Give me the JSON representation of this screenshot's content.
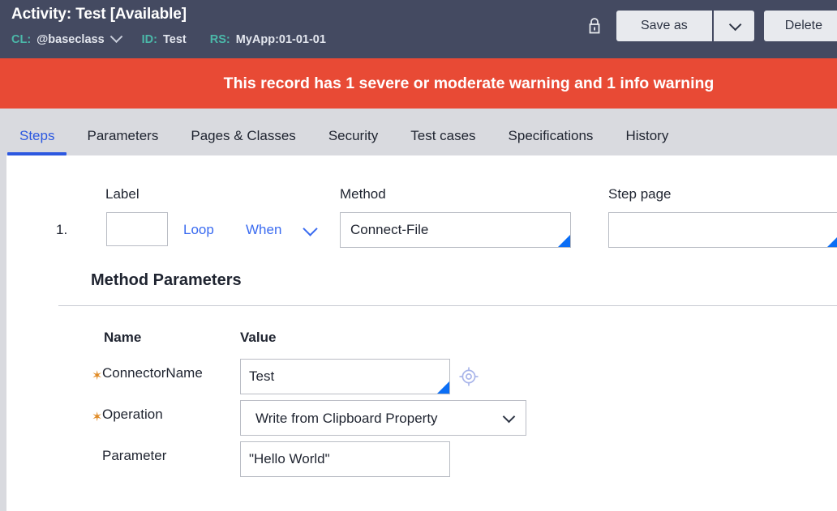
{
  "header": {
    "title_label": "Activity:",
    "title_name": "Test",
    "title_state": "[Available]",
    "cl_key": "CL:",
    "cl_value": "@baseclass",
    "id_key": "ID:",
    "id_value": "Test",
    "rs_key": "RS:",
    "rs_value": "MyApp:01-01-01",
    "lock_icon": "lock-icon",
    "save_as_label": "Save as",
    "save_as_caret_icon": "chevron-down-icon",
    "delete_label": "Delete",
    "bg_color": "#444a61",
    "accent_teal": "#4bb8a9"
  },
  "banner": {
    "message": "This record has 1 severe or moderate warning and 1 info warning",
    "bg_color": "#e84a35"
  },
  "tabs": [
    {
      "label": "Steps",
      "active": true
    },
    {
      "label": "Parameters",
      "active": false
    },
    {
      "label": "Pages & Classes",
      "active": false
    },
    {
      "label": "Security",
      "active": false
    },
    {
      "label": "Test cases",
      "active": false
    },
    {
      "label": "Specifications",
      "active": false
    },
    {
      "label": "History",
      "active": false
    }
  ],
  "tabbar": {
    "bg_color": "#d9dadf",
    "active_color": "#2c58e0"
  },
  "step": {
    "col_label": "Label",
    "col_method": "Method",
    "col_steppage": "Step page",
    "number": "1.",
    "label_value": "",
    "label_placeholder": "",
    "loop_link": "Loop",
    "when_link": "When",
    "when_caret_icon": "chevron-down-icon",
    "method_value": "Connect-File",
    "steppage_value": "",
    "autocomplete_marker_color": "#0b6ef5"
  },
  "method_parameters": {
    "section_title": "Method Parameters",
    "col_name": "Name",
    "col_value": "Value",
    "required_marker": "✶",
    "required_color": "#e08a24",
    "rows": [
      {
        "name": "ConnectorName",
        "required": true,
        "control": "text",
        "value": "Test",
        "has_target_icon": true,
        "target_icon": "crosshair-icon"
      },
      {
        "name": "Operation",
        "required": true,
        "control": "select",
        "value": "Write from Clipboard Property",
        "options": [
          "Write from Clipboard Property"
        ]
      },
      {
        "name": "Parameter",
        "required": false,
        "control": "text",
        "value": "\"Hello World\""
      }
    ]
  }
}
